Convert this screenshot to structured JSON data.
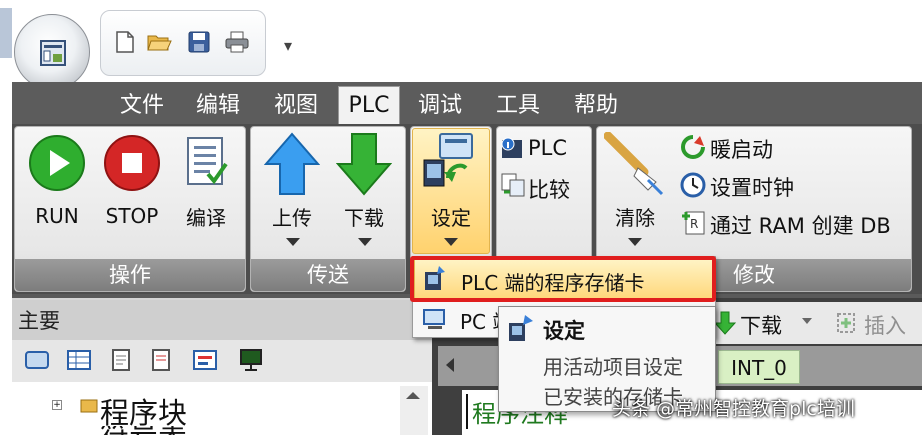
{
  "menu_tabs": [
    "文件",
    "编辑",
    "视图",
    "PLC",
    "调试",
    "工具",
    "帮助"
  ],
  "groups": {
    "operation": {
      "label": "操作",
      "run": "RUN",
      "stop": "STOP",
      "compile": "编译"
    },
    "transfer": {
      "label": "传送",
      "upload": "上传",
      "download": "下载"
    },
    "setting": {
      "label": "设定"
    },
    "info": {
      "plc": "PLC",
      "compare": "比较"
    },
    "modify": {
      "label": "修改",
      "clear": "清除",
      "warm_start": "暖启动",
      "set_clock": "设置时钟",
      "create_db": "通过 RAM 创建 DB"
    }
  },
  "dropdown": {
    "plc_storage": "PLC 端的程序存储卡",
    "pc_partial": "PC 端"
  },
  "submenu": {
    "title": "设定",
    "item1": "用活动项目设定",
    "item2": "已安装的存储卡"
  },
  "left_panel": {
    "title": "主要",
    "tree_item": "程序块",
    "tree_item2": "符号表"
  },
  "right_toolbar": {
    "download": "下载",
    "insert": "插入"
  },
  "editor": {
    "tab": "INT_0",
    "comment": "程序注释"
  },
  "watermark": "头条 @常州智控教育plc培训",
  "colors": {
    "ribbon": "#5a5a5a",
    "highlight": "#e01e1e",
    "hover": "#ffd77a",
    "int_tab": "#d9f0c4"
  }
}
